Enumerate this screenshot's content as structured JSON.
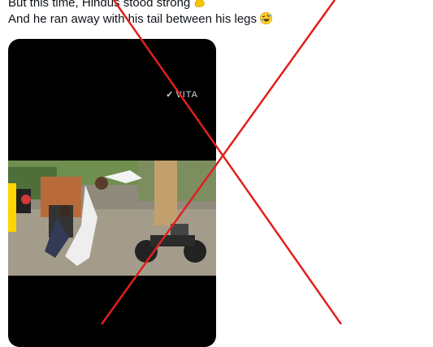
{
  "tweet": {
    "line1": "But this time, Hindus stood strong",
    "line1_emoji": "flexed-biceps-emoji",
    "line2": "And he ran away with his tail between his legs",
    "line2_emoji": "rolling-on-floor-laughing-emoji"
  },
  "media": {
    "watermark": "VITA",
    "watermark_icon": "v-logo-icon"
  },
  "overlay": {
    "mark": "red-x-cross",
    "color": "#e0201f"
  }
}
